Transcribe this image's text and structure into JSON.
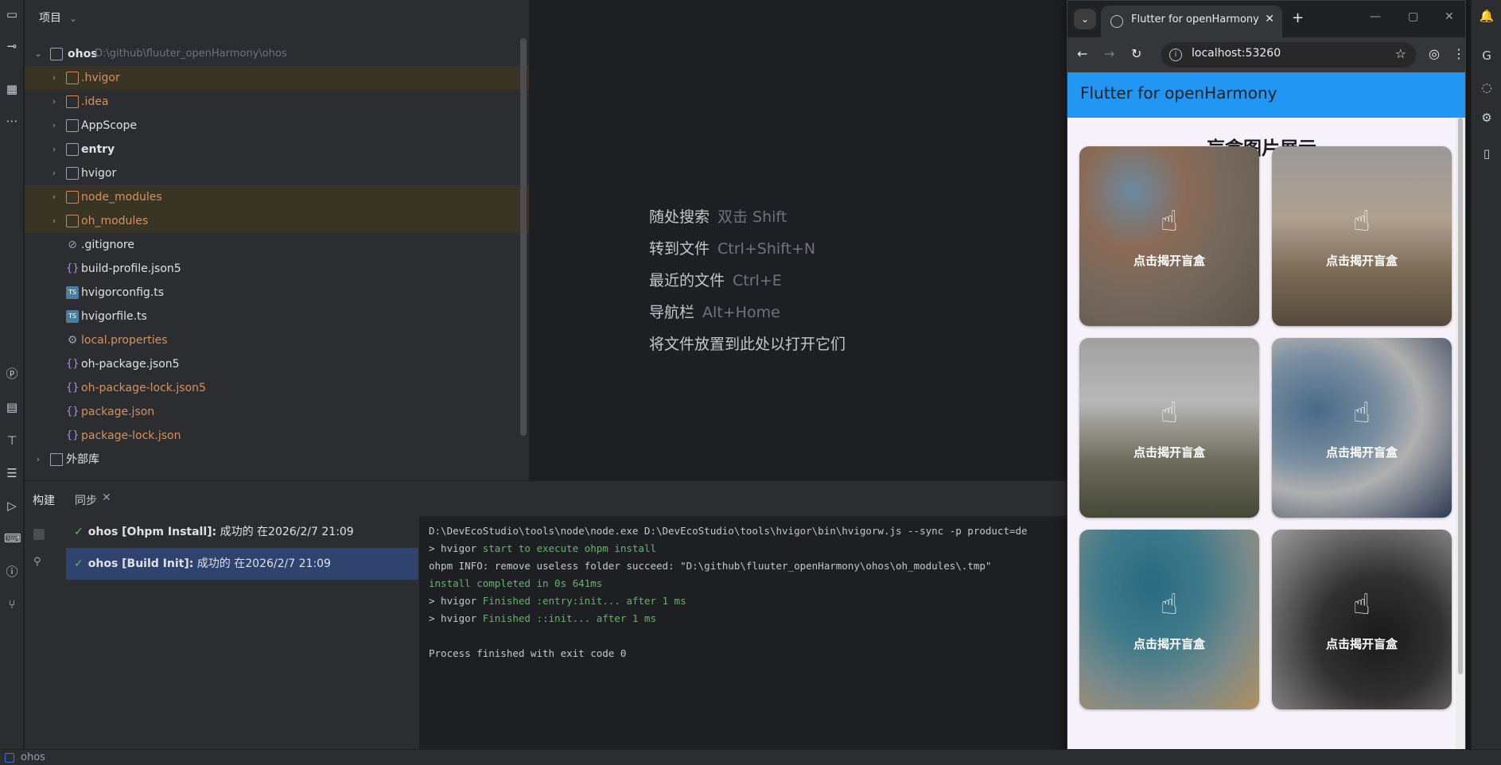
{
  "project": {
    "header": "项目",
    "root_name": "ohos",
    "root_path": "D:\\github\\fluuter_openHarmony\\ohos",
    "items": [
      {
        "label": ".hvigor",
        "kind": "folder",
        "style": "orange"
      },
      {
        "label": ".idea",
        "kind": "folder",
        "style": "orange"
      },
      {
        "label": "AppScope",
        "kind": "folder",
        "style": "normal"
      },
      {
        "label": "entry",
        "kind": "folder",
        "style": "bold"
      },
      {
        "label": "hvigor",
        "kind": "folder",
        "style": "normal"
      },
      {
        "label": "node_modules",
        "kind": "folder",
        "style": "orange"
      },
      {
        "label": "oh_modules",
        "kind": "folder",
        "style": "orange"
      },
      {
        "label": ".gitignore",
        "kind": "file",
        "style": "normal"
      },
      {
        "label": "build-profile.json5",
        "kind": "json",
        "style": "normal"
      },
      {
        "label": "hvigorconfig.ts",
        "kind": "ts",
        "style": "normal"
      },
      {
        "label": "hvigorfile.ts",
        "kind": "ts",
        "style": "normal"
      },
      {
        "label": "local.properties",
        "kind": "gear",
        "style": "orange"
      },
      {
        "label": "oh-package.json5",
        "kind": "json",
        "style": "normal"
      },
      {
        "label": "oh-package-lock.json5",
        "kind": "json",
        "style": "orange"
      },
      {
        "label": "package.json",
        "kind": "json",
        "style": "orange"
      },
      {
        "label": "package-lock.json",
        "kind": "json",
        "style": "orange"
      }
    ],
    "external_libs": "外部库"
  },
  "editor": {
    "hints": [
      {
        "label": "随处搜索",
        "key": "双击 Shift"
      },
      {
        "label": "转到文件",
        "key": "Ctrl+Shift+N"
      },
      {
        "label": "最近的文件",
        "key": "Ctrl+E"
      },
      {
        "label": "导航栏",
        "key": "Alt+Home"
      },
      {
        "label": "将文件放置到此处以打开它们",
        "key": ""
      }
    ]
  },
  "build": {
    "tab_build": "构建",
    "tab_sync": "同步",
    "tasks": [
      {
        "name": "ohos [Ohpm Install]:",
        "status": "成功的",
        "time": "在2026/2/7 21:09"
      },
      {
        "name": "ohos [Build Init]:",
        "status": "成功的",
        "time": "在2026/2/7 21:09"
      }
    ],
    "console": [
      {
        "prefix": "D:\\DevEcoStudio\\tools\\node\\node.exe D:\\DevEcoStudio\\tools\\hvigor\\bin\\hvigorw.js --sync -p product=de",
        "rest": ""
      },
      {
        "prefix": "> hvigor ",
        "rest": "start to execute ohpm install"
      },
      {
        "prefix": "ohpm INFO: remove useless folder succeed: \"D:\\github\\fluuter_openHarmony\\ohos\\oh_modules\\.tmp\"",
        "rest": ""
      },
      {
        "prefix": "",
        "rest": "install completed in 0s 641ms"
      },
      {
        "prefix": "> hvigor ",
        "rest": "Finished :entry:init... after 1 ms"
      },
      {
        "prefix": "> hvigor ",
        "rest": "Finished ::init... after 1 ms"
      },
      {
        "prefix": "",
        "rest": ""
      },
      {
        "prefix": "Process finished with exit code 0",
        "rest": ""
      }
    ]
  },
  "status_bar": {
    "project": "ohos"
  },
  "browser": {
    "tab_title": "Flutter for openHarmony",
    "url": "localhost:53260"
  },
  "app": {
    "appbar_title": "Flutter for openHarmony",
    "heading": "盲盒图片展示",
    "cards": [
      {
        "label": "点击揭开盲盒"
      },
      {
        "label": "点击揭开盲盒"
      },
      {
        "label": "点击揭开盲盒"
      },
      {
        "label": "点击揭开盲盒"
      },
      {
        "label": "点击揭开盲盒"
      },
      {
        "label": "点击揭开盲盒"
      }
    ]
  },
  "colors": {
    "accent_blue": "#2196f3",
    "success_green": "#5fb865",
    "selection_blue": "#2e436e"
  }
}
